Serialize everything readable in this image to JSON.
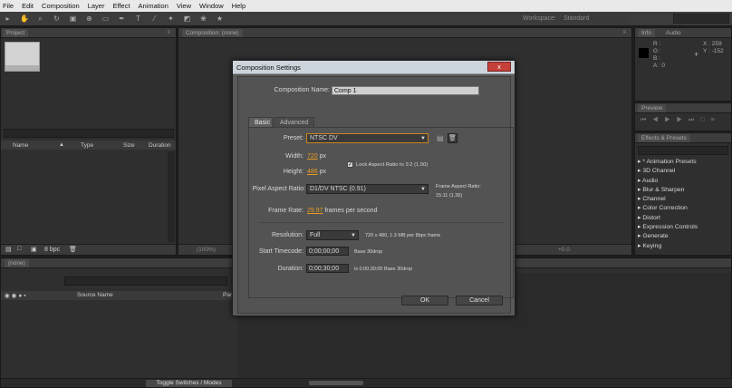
{
  "menu": [
    "File",
    "Edit",
    "Composition",
    "Layer",
    "Effect",
    "Animation",
    "View",
    "Window",
    "Help"
  ],
  "toolbar": {
    "workspace_label": "Workspace:",
    "workspace_value": "Standard"
  },
  "project": {
    "tab_label": "Project",
    "columns": [
      "Name",
      "Type",
      "Size",
      "Duration"
    ],
    "bpc": "8 bpc"
  },
  "composition": {
    "tab_label": "Composition: (none)",
    "zoom": "(100%)",
    "exposure": "+0.0"
  },
  "info_panel": {
    "tabs": [
      "Info",
      "Audio"
    ],
    "r": "R :",
    "g": "G :",
    "b": "B :",
    "a": "A : 0",
    "x": "X : 259",
    "y": "Y : -152"
  },
  "preview_panel": {
    "tab_label": "Preview"
  },
  "effects_panel": {
    "tab_label": "Effects & Presets",
    "items": [
      "* Animation Presets",
      "3D Channel",
      "Audio",
      "Blur & Sharpen",
      "Channel",
      "Color Correction",
      "Distort",
      "Expression Controls",
      "Generate",
      "Keying"
    ]
  },
  "timeline": {
    "tab_label": "(none)",
    "source_name_col": "Source Name",
    "parent_col": "Pare",
    "toggle_button": "Toggle Switches / Modes"
  },
  "dialog": {
    "title": "Composition Settings",
    "close": "x",
    "comp_name_label": "Composition Name:",
    "comp_name_value": "Comp 1",
    "tabs": [
      "Basic",
      "Advanced"
    ],
    "preset_label": "Preset:",
    "preset_value": "NTSC DV",
    "width_label": "Width:",
    "width_value": "720",
    "height_label": "Height:",
    "height_value": "486",
    "px": "px",
    "lock_aspect": "Lock Aspect Ratio to 3:2 (1.50)",
    "par_label": "Pixel Aspect Ratio:",
    "par_value": "D1/DV NTSC (0.91)",
    "frame_aspect_label": "Frame Aspect Ratio:",
    "frame_aspect_value": "15:11 (1.36)",
    "frame_rate_label": "Frame Rate:",
    "frame_rate_value": "29.97",
    "frame_rate_unit": "frames per second",
    "resolution_label": "Resolution:",
    "resolution_value": "Full",
    "resolution_info": "720 x 480, 1.3 MB per 8bpc frame",
    "start_tc_label": "Start Timecode:",
    "start_tc_value": "0;00;00;00",
    "start_tc_base": "Base 30drop",
    "duration_label": "Duration:",
    "duration_value": "0;00;30;00",
    "duration_info": "is 0;00;30;00  Base 30drop",
    "ok": "OK",
    "cancel": "Cancel"
  }
}
